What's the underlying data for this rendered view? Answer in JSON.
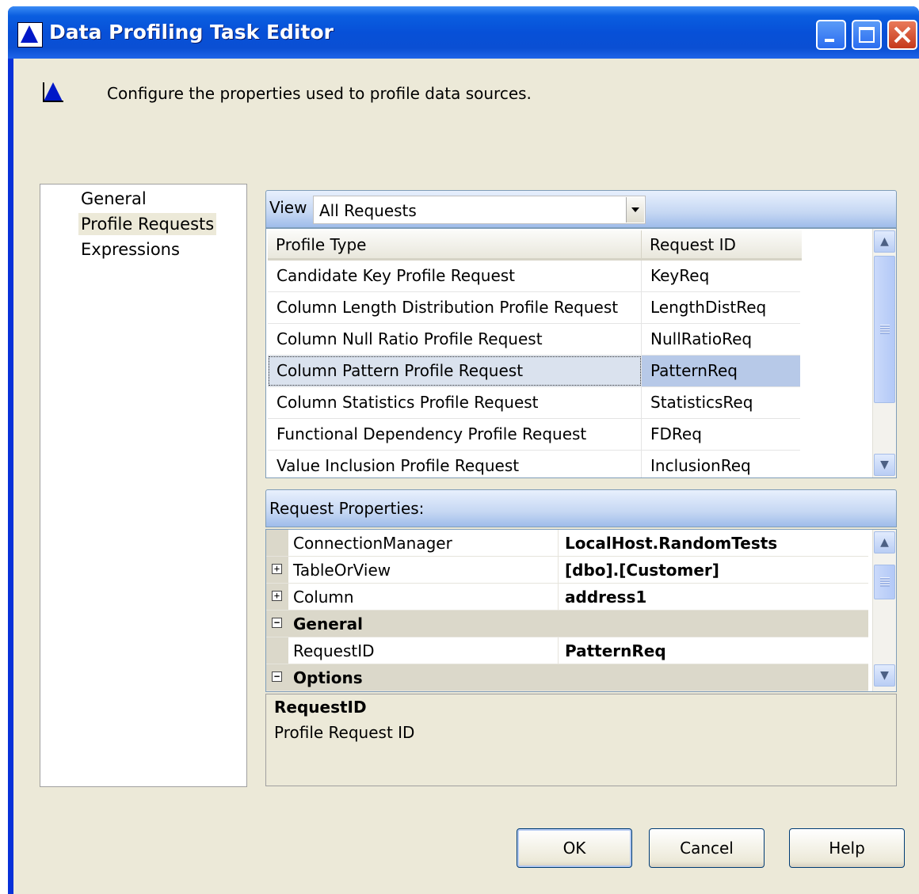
{
  "window": {
    "title": "Data Profiling Task Editor",
    "minimize": "minimize",
    "maximize": "maximize",
    "close": "close"
  },
  "header": {
    "description": "Configure the properties used to profile data sources."
  },
  "nav": {
    "items": [
      {
        "label": "General",
        "selected": false
      },
      {
        "label": "Profile Requests",
        "selected": true
      },
      {
        "label": "Expressions",
        "selected": false
      }
    ]
  },
  "view": {
    "label": "View",
    "selected": "All Requests"
  },
  "requests_grid": {
    "columns": [
      "Profile Type",
      "Request ID"
    ],
    "rows": [
      {
        "type": "Candidate Key Profile Request",
        "id": "KeyReq"
      },
      {
        "type": "Column Length Distribution Profile Request",
        "id": "LengthDistReq"
      },
      {
        "type": "Column Null Ratio Profile Request",
        "id": "NullRatioReq"
      },
      {
        "type": "Column Pattern Profile Request",
        "id": "PatternReq",
        "selected": true
      },
      {
        "type": "Column Statistics Profile Request",
        "id": "StatisticsReq"
      },
      {
        "type": "Functional Dependency Profile Request",
        "id": "FDReq"
      },
      {
        "type": "Value Inclusion Profile Request",
        "id": "InclusionReq"
      }
    ]
  },
  "request_properties": {
    "label": "Request Properties:",
    "rows": [
      {
        "name": "ConnectionManager",
        "value": "LocalHost.RandomTests"
      },
      {
        "name": "TableOrView",
        "value": "[dbo].[Customer]",
        "expander": "+"
      },
      {
        "name": "Column",
        "value": "address1",
        "expander": "+"
      },
      {
        "name": "General",
        "category": true,
        "expander": "−"
      },
      {
        "name": "RequestID",
        "value": "PatternReq"
      },
      {
        "name": "Options",
        "category": true,
        "expander": "−"
      }
    ]
  },
  "description": {
    "title": "RequestID",
    "text": "Profile Request ID"
  },
  "buttons": {
    "ok": "OK",
    "cancel": "Cancel",
    "help": "Help"
  },
  "colors": {
    "title_bar": "#0a5ee0",
    "dialog_bg": "#ece9d8",
    "selection": "#b7c9e8"
  }
}
